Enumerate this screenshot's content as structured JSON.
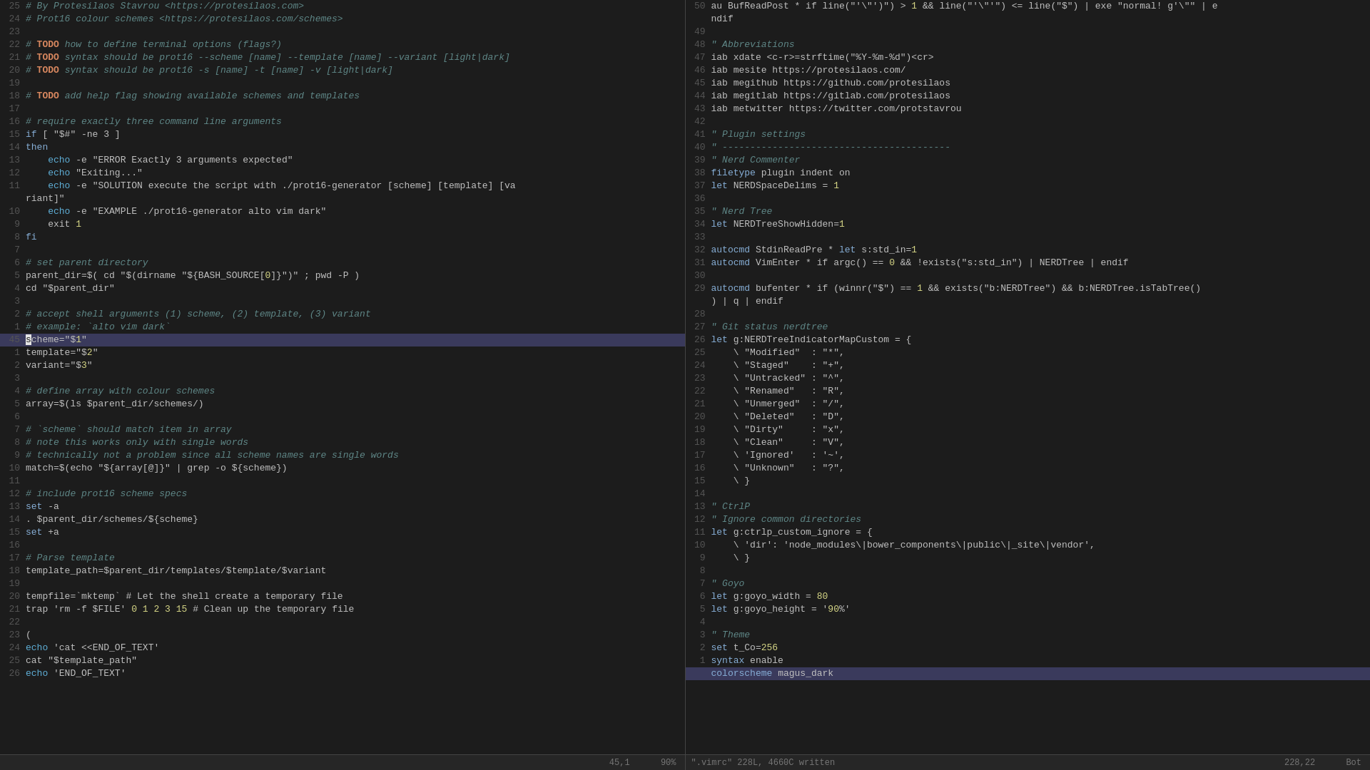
{
  "left_pane": {
    "lines": [
      {
        "num": "25",
        "content": "# By Protesilaos Stavrou <https://protesilaos.com>",
        "type": "comment"
      },
      {
        "num": "24",
        "content": "# Prot16 colour schemes <https://protesilaos.com/schemes>",
        "type": "comment"
      },
      {
        "num": "23",
        "content": "",
        "type": "blank"
      },
      {
        "num": "22",
        "content": "# TODO how to define terminal options (flags?)",
        "type": "comment-todo"
      },
      {
        "num": "21",
        "content": "# TODO syntax should be prot16 --scheme [name] --template [name] --variant [light|dark]",
        "type": "comment-todo"
      },
      {
        "num": "20",
        "content": "# TODO syntax should be prot16 -s [name] -t [name] -v [light|dark]",
        "type": "comment-todo"
      },
      {
        "num": "19",
        "content": "",
        "type": "blank"
      },
      {
        "num": "18",
        "content": "# TODO add help flag showing available schemes and templates",
        "type": "comment-todo"
      },
      {
        "num": "17",
        "content": "",
        "type": "blank"
      },
      {
        "num": "16",
        "content": "# require exactly three command line arguments",
        "type": "comment"
      },
      {
        "num": "15",
        "content": "if [ \"$#\" -ne 3 ]",
        "type": "code-if"
      },
      {
        "num": "14",
        "content": "then",
        "type": "code-then"
      },
      {
        "num": "13",
        "content": "    echo -e \"ERROR Exactly 3 arguments expected\"",
        "type": "code-echo"
      },
      {
        "num": "12",
        "content": "    echo \"Exiting...\"",
        "type": "code-echo"
      },
      {
        "num": "11",
        "content": "    echo -e \"SOLUTION execute the script with ./prot16-generator [scheme] [template] [va",
        "type": "code-echo"
      },
      {
        "num": "",
        "content": "riant]\"",
        "type": "code-cont"
      },
      {
        "num": "10",
        "content": "    echo -e \"EXAMPLE ./prot16-generator alto vim dark\"",
        "type": "code-echo"
      },
      {
        "num": "9",
        "content": "    exit 1",
        "type": "code"
      },
      {
        "num": "8",
        "content": "fi",
        "type": "code-fi"
      },
      {
        "num": "7",
        "content": "",
        "type": "blank"
      },
      {
        "num": "6",
        "content": "# set parent directory",
        "type": "comment"
      },
      {
        "num": "5",
        "content": "parent_dir=$( cd \"$(dirname \"${BASH_SOURCE[0]}\")\" ; pwd -P )",
        "type": "code"
      },
      {
        "num": "4",
        "content": "cd \"$parent_dir\"",
        "type": "code"
      },
      {
        "num": "3",
        "content": "",
        "type": "blank"
      },
      {
        "num": "2",
        "content": "# accept shell arguments (1) scheme, (2) template, (3) variant",
        "type": "comment"
      },
      {
        "num": "1",
        "content": "# example: `alto vim dark`",
        "type": "comment"
      },
      {
        "num": "45",
        "content": "scheme=\"$1\"",
        "type": "code",
        "highlighted": true
      },
      {
        "num": "1",
        "content": "template=\"$2\"",
        "type": "code"
      },
      {
        "num": "2",
        "content": "variant=\"$3\"",
        "type": "code"
      },
      {
        "num": "3",
        "content": "",
        "type": "blank"
      },
      {
        "num": "4",
        "content": "# define array with colour schemes",
        "type": "comment"
      },
      {
        "num": "5",
        "content": "array=$(ls $parent_dir/schemes/)",
        "type": "code"
      },
      {
        "num": "6",
        "content": "",
        "type": "blank"
      },
      {
        "num": "7",
        "content": "# `scheme` should match item in array",
        "type": "comment"
      },
      {
        "num": "8",
        "content": "# note this works only with single words",
        "type": "comment"
      },
      {
        "num": "9",
        "content": "# technically not a problem since all scheme names are single words",
        "type": "comment"
      },
      {
        "num": "10",
        "content": "match=$(echo \"${array[@]}\" | grep -o ${scheme})",
        "type": "code"
      },
      {
        "num": "11",
        "content": "",
        "type": "blank"
      },
      {
        "num": "12",
        "content": "# include prot16 scheme specs",
        "type": "comment"
      },
      {
        "num": "13",
        "content": "set -a",
        "type": "code"
      },
      {
        "num": "14",
        "content": ". $parent_dir/schemes/${scheme}",
        "type": "code"
      },
      {
        "num": "15",
        "content": "set +a",
        "type": "code"
      },
      {
        "num": "16",
        "content": "",
        "type": "blank"
      },
      {
        "num": "17",
        "content": "# Parse template",
        "type": "comment"
      },
      {
        "num": "18",
        "content": "template_path=$parent_dir/templates/$template/$variant",
        "type": "code"
      },
      {
        "num": "19",
        "content": "",
        "type": "blank"
      },
      {
        "num": "20",
        "content": "tempfile=`mktemp` # Let the shell create a temporary file",
        "type": "code"
      },
      {
        "num": "21",
        "content": "trap 'rm -f $FILE' 0 1 2 3 15 # Clean up the temporary file",
        "type": "code"
      },
      {
        "num": "22",
        "content": "",
        "type": "blank"
      },
      {
        "num": "23",
        "content": "(",
        "type": "code"
      },
      {
        "num": "24",
        "content": "echo 'cat <<END_OF_TEXT'",
        "type": "code-echo"
      },
      {
        "num": "25",
        "content": "cat \"$template_path\"",
        "type": "code"
      },
      {
        "num": "26",
        "content": "echo 'END_OF_TEXT'",
        "type": "code-echo"
      }
    ],
    "status": {
      "position": "45,1",
      "percent": "90%"
    }
  },
  "right_pane": {
    "lines": [
      {
        "num": "50",
        "content": "au BufReadPost * if line(\"'\\\"')\") > 1 && line(\"'\\\"'\") <= line(\"$\") | exe \"normal! g'\\\"\" | e",
        "type": "code"
      },
      {
        "num": "",
        "content": "ndif",
        "type": "code-cont"
      },
      {
        "num": "49",
        "content": "",
        "type": "blank"
      },
      {
        "num": "48",
        "content": "\" Abbreviations",
        "type": "comment"
      },
      {
        "num": "47",
        "content": "iab xdate <c-r>=strftime(\"%Y-%m-%d\")<cr>",
        "type": "code"
      },
      {
        "num": "46",
        "content": "iab mesite https://protesilaos.com/",
        "type": "code"
      },
      {
        "num": "45",
        "content": "iab megithub https://github.com/protesilaos",
        "type": "code"
      },
      {
        "num": "44",
        "content": "iab megitlab https://gitlab.com/protesilaos",
        "type": "code"
      },
      {
        "num": "43",
        "content": "iab metwitter https://twitter.com/protstavrou",
        "type": "code"
      },
      {
        "num": "42",
        "content": "",
        "type": "blank"
      },
      {
        "num": "41",
        "content": "\" Plugin settings",
        "type": "comment"
      },
      {
        "num": "40",
        "content": "\" -----------------------------------------",
        "type": "comment"
      },
      {
        "num": "39",
        "content": "\" Nerd Commenter",
        "type": "comment"
      },
      {
        "num": "38",
        "content": "filetype plugin indent on",
        "type": "code"
      },
      {
        "num": "37",
        "content": "let NERDSpaceDelims = 1",
        "type": "code"
      },
      {
        "num": "36",
        "content": "",
        "type": "blank"
      },
      {
        "num": "35",
        "content": "\" Nerd Tree",
        "type": "comment"
      },
      {
        "num": "34",
        "content": "let NERDTreeShowHidden=1",
        "type": "code"
      },
      {
        "num": "33",
        "content": "",
        "type": "blank"
      },
      {
        "num": "32",
        "content": "autocmd StdinReadPre * let s:std_in=1",
        "type": "code"
      },
      {
        "num": "31",
        "content": "autocmd VimEnter * if argc() == 0 && !exists(\"s:std_in\") | NERDTree | endif",
        "type": "code"
      },
      {
        "num": "30",
        "content": "",
        "type": "blank"
      },
      {
        "num": "29",
        "content": "autocmd bufenter * if (winnr(\"$\") == 1 && exists(\"b:NERDTree\") && b:NERDTree.isTabTree()",
        "type": "code"
      },
      {
        "num": "",
        "content": ") | q | endif",
        "type": "code-cont"
      },
      {
        "num": "28",
        "content": "",
        "type": "blank"
      },
      {
        "num": "27",
        "content": "\" Git status nerdtree",
        "type": "comment"
      },
      {
        "num": "26",
        "content": "let g:NERDTreeIndicatorMapCustom = {",
        "type": "code"
      },
      {
        "num": "25",
        "content": "    \\ \"Modified\"  : \"*\",",
        "type": "code"
      },
      {
        "num": "24",
        "content": "    \\ \"Staged\"    : \"+\",",
        "type": "code"
      },
      {
        "num": "23",
        "content": "    \\ \"Untracked\" : \"^\",",
        "type": "code"
      },
      {
        "num": "22",
        "content": "    \\ \"Renamed\"   : \"R\",",
        "type": "code"
      },
      {
        "num": "21",
        "content": "    \\ \"Unmerged\"  : \"/\",",
        "type": "code"
      },
      {
        "num": "20",
        "content": "    \\ \"Deleted\"   : \"D\",",
        "type": "code"
      },
      {
        "num": "19",
        "content": "    \\ \"Dirty\"     : \"x\",",
        "type": "code"
      },
      {
        "num": "18",
        "content": "    \\ \"Clean\"     : \"V\",",
        "type": "code"
      },
      {
        "num": "17",
        "content": "    \\ 'Ignored'   : '~',",
        "type": "code"
      },
      {
        "num": "16",
        "content": "    \\ \"Unknown\"   : \"?\",",
        "type": "code"
      },
      {
        "num": "15",
        "content": "    \\ }",
        "type": "code"
      },
      {
        "num": "14",
        "content": "",
        "type": "blank"
      },
      {
        "num": "13",
        "content": "\" CtrlP",
        "type": "comment"
      },
      {
        "num": "12",
        "content": "\" Ignore common directories",
        "type": "comment"
      },
      {
        "num": "11",
        "content": "let g:ctrlp_custom_ignore = {",
        "type": "code"
      },
      {
        "num": "10",
        "content": "    \\ 'dir': 'node_modules\\|bower_components\\|public\\|_site\\|vendor',",
        "type": "code"
      },
      {
        "num": "9",
        "content": "    \\ }",
        "type": "code"
      },
      {
        "num": "8",
        "content": "",
        "type": "blank"
      },
      {
        "num": "7",
        "content": "\" Goyo",
        "type": "comment"
      },
      {
        "num": "6",
        "content": "let g:goyo_width = 80",
        "type": "code"
      },
      {
        "num": "5",
        "content": "let g:goyo_height = '90%'",
        "type": "code"
      },
      {
        "num": "4",
        "content": "",
        "type": "blank"
      },
      {
        "num": "3",
        "content": "\" Theme",
        "type": "comment"
      },
      {
        "num": "2",
        "content": "set t_Co=256",
        "type": "code"
      },
      {
        "num": "1",
        "content": "syntax enable",
        "type": "code"
      },
      {
        "num": "",
        "content": "colorscheme magus_dark",
        "type": "code",
        "highlighted": true
      }
    ],
    "status": {
      "line": "228",
      "position": "228,22",
      "bot": "Bot"
    },
    "cmdline": "\".vimrc\" 228L, 4660C written"
  }
}
